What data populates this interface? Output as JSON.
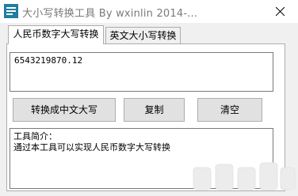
{
  "window": {
    "title": "大小写转换工具 By wxinlin 2014-...",
    "close_icon": "close-icon",
    "app_icon": "app-icon"
  },
  "tabs": [
    {
      "label": "人民币数字大写转换",
      "active": true
    },
    {
      "label": "英文大小写转换",
      "active": false
    }
  ],
  "amount_input": {
    "value": "6543219870.12"
  },
  "buttons": {
    "convert_label": "转换成中文大写",
    "copy_label": "复制",
    "clear_label": "清空"
  },
  "info": {
    "line1": "工具简介：",
    "line2": "通过本工具可以实现人民币数字大写转换"
  },
  "colors": {
    "window_bg": "#f0f0f0",
    "button_bg": "#e1e1e1",
    "border": "#adadad",
    "title_text": "#7a7a7a"
  }
}
